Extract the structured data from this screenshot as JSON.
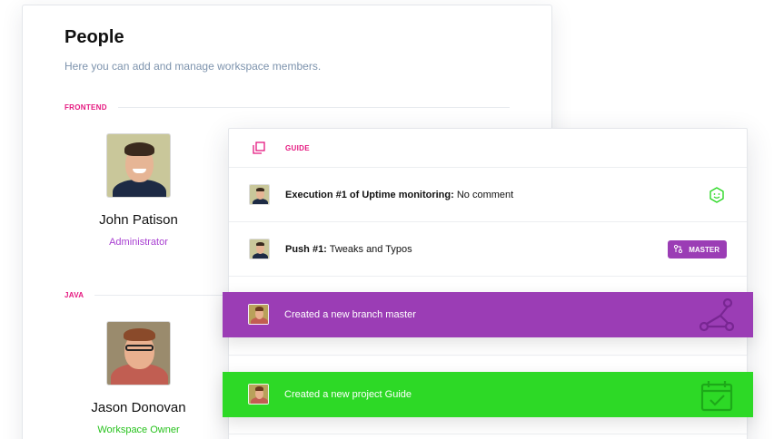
{
  "people": {
    "title": "People",
    "subtitle": "Here you can add and manage workspace members.",
    "sections": [
      {
        "label": "FRONTEND",
        "member": {
          "name": "John Patison",
          "role": "Administrator",
          "role_color": "#a83fd1"
        }
      },
      {
        "label": "JAVA",
        "member": {
          "name": "Jason Donovan",
          "role": "Workspace Owner",
          "role_color": "#28c21e"
        }
      }
    ]
  },
  "activity": {
    "header_label": "GUIDE",
    "header_icon": "copy-icon",
    "rows": [
      {
        "bold": "Execution #1 of Uptime monitoring:",
        "rest": " No comment",
        "status_icon": "smile-face-icon",
        "status_color": "#2dd926"
      },
      {
        "bold": "Push #1:",
        "rest": " Tweaks and Typos",
        "badge": "MASTER",
        "badge_icon": "branch-icon"
      }
    ],
    "bands": [
      {
        "text": "Created a new branch master",
        "color": "#9b3db5",
        "deco_icon": "branch-network-icon"
      },
      {
        "text": "Created a new project Guide",
        "color": "#2dd926",
        "deco_icon": "calendar-check-icon"
      }
    ]
  },
  "colors": {
    "accent_pink": "#e5177f",
    "purple": "#9b3db5",
    "green": "#2dd926",
    "subtitle_blue": "#7d93ad"
  }
}
